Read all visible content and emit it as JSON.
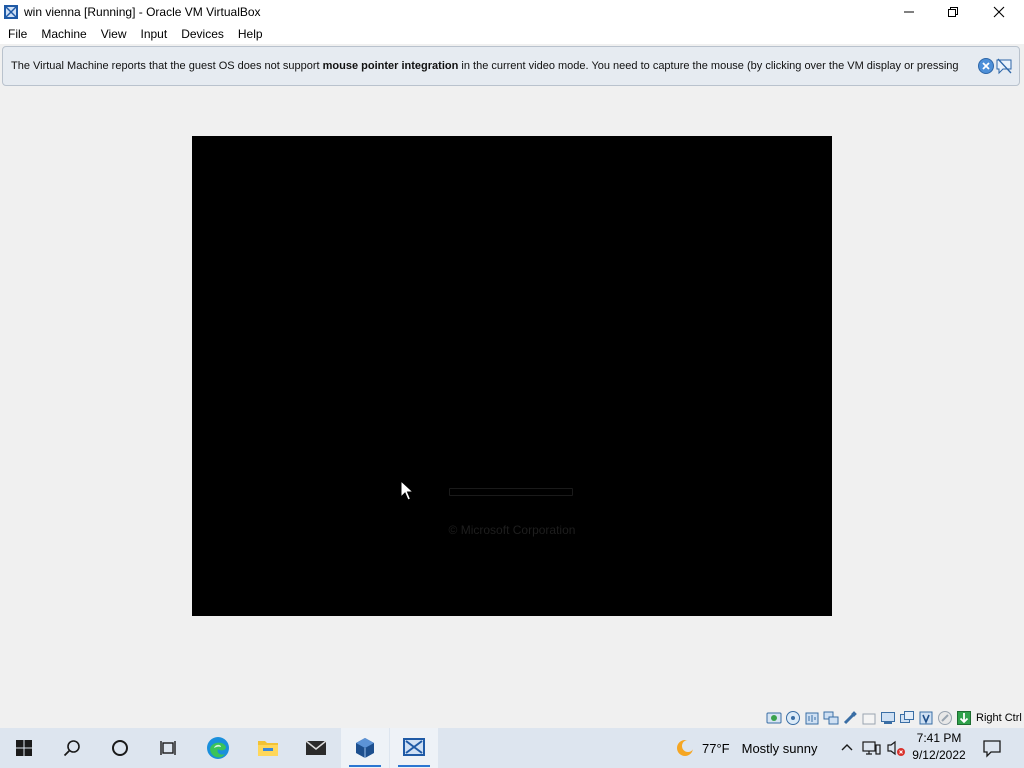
{
  "window": {
    "title": "win vienna [Running] - Oracle VM VirtualBox"
  },
  "menu": {
    "items": [
      {
        "label": "File"
      },
      {
        "label": "Machine"
      },
      {
        "label": "View"
      },
      {
        "label": "Input"
      },
      {
        "label": "Devices"
      },
      {
        "label": "Help"
      }
    ]
  },
  "notice": {
    "prefix": "The Virtual Machine reports that the guest OS does not support ",
    "bold": "mouse pointer integration",
    "suffix": " in the current video mode. You need to capture the mouse (by clicking over the VM display or pressing"
  },
  "vm_screen": {
    "copyright": "© Microsoft Corporation"
  },
  "statusbar": {
    "host_key": "Right Ctrl",
    "icons": [
      "hard-disk-icon",
      "optical-drive-icon",
      "audio-icon",
      "network-icon",
      "usb-icon",
      "shared-folders-icon",
      "display-icon",
      "video-capture-icon",
      "recording-icon",
      "vt-x-icon",
      "mouse-integration-icon",
      "keyboard-capture-icon"
    ]
  },
  "taskbar": {
    "weather_temp": "77°F",
    "weather_desc": "Mostly sunny",
    "time": "7:41 PM",
    "date": "9/12/2022"
  },
  "colors": {
    "taskbar": "#dde5ef",
    "notice_bg": "#e6ebf1",
    "vm_bg": "#000000",
    "accent": "#2a76d2"
  }
}
